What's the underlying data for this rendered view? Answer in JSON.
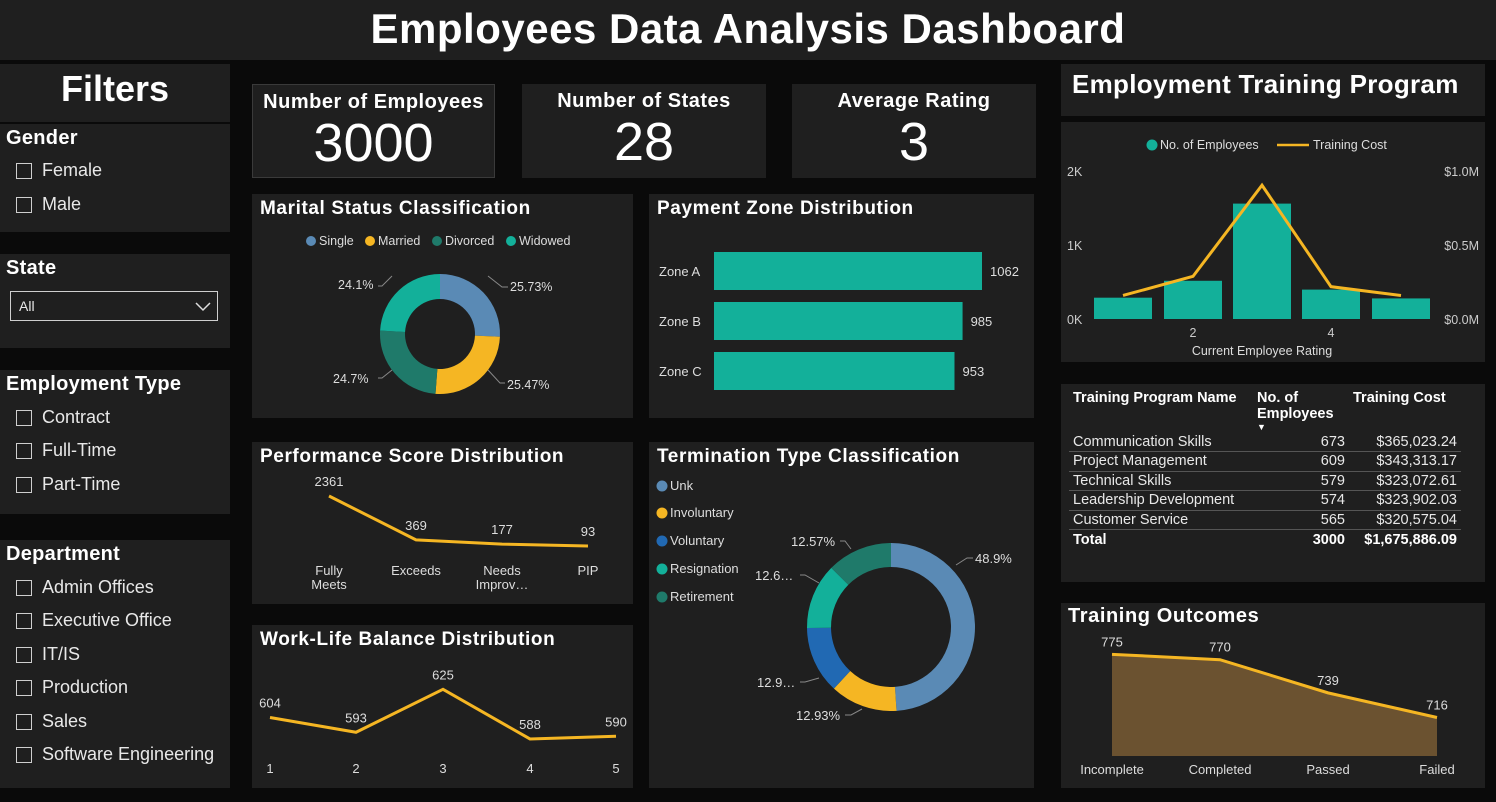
{
  "header": {
    "title": "Employees Data Analysis Dashboard"
  },
  "filters": {
    "title": "Filters",
    "gender": {
      "label": "Gender",
      "options": [
        "Female",
        "Male"
      ]
    },
    "state": {
      "label": "State",
      "selected": "All"
    },
    "employment_type": {
      "label": "Employment Type",
      "options": [
        "Contract",
        "Full-Time",
        "Part-Time"
      ]
    },
    "department": {
      "label": "Department",
      "options": [
        "Admin Offices",
        "Executive Office",
        "IT/IS",
        "Production",
        "Sales",
        "Software Engineering"
      ]
    }
  },
  "kpis": [
    {
      "title": "Number of Employees",
      "value": "3000"
    },
    {
      "title": "Number of States",
      "value": "28"
    },
    {
      "title": "Average Rating",
      "value": "3"
    }
  ],
  "colors": {
    "teal": "#13b09a",
    "gold": "#f5b623",
    "steel_blue": "#5a8ab5",
    "dark_teal": "#1f7a6a",
    "blue": "#2169b3",
    "brown_fill": "#6b5230",
    "panel": "#1f1f1f"
  },
  "marital": {
    "title": "Marital Status Classification",
    "legend": [
      "Single",
      "Married",
      "Divorced",
      "Widowed"
    ],
    "labels": [
      "25.73%",
      "25.47%",
      "24.7%",
      "24.1%"
    ],
    "chart_data": {
      "type": "pie",
      "categories": [
        "Single",
        "Married",
        "Divorced",
        "Widowed"
      ],
      "values": [
        25.73,
        25.47,
        24.7,
        24.1
      ]
    }
  },
  "payment_zone": {
    "title": "Payment Zone Distribution",
    "chart_data": {
      "type": "bar",
      "categories": [
        "Zone A",
        "Zone B",
        "Zone C"
      ],
      "values": [
        1062,
        985,
        953
      ]
    }
  },
  "performance": {
    "title": "Performance Score Distribution",
    "categories": [
      "Fully\nMeets",
      "Exceeds",
      "Needs\nImprov…",
      "PIP"
    ],
    "chart_data": {
      "type": "line",
      "categories": [
        "Fully Meets",
        "Exceeds",
        "Needs Improvement",
        "PIP"
      ],
      "values": [
        2361,
        369,
        177,
        93
      ]
    }
  },
  "termination": {
    "title": "Termination Type Classification",
    "legend": [
      "Unk",
      "Involuntary",
      "Voluntary",
      "Resignation",
      "Retirement"
    ],
    "labels": [
      "48.9%",
      "12.93%",
      "12.9…",
      "12.6…",
      "12.57%"
    ],
    "chart_data": {
      "type": "pie",
      "categories": [
        "Unk",
        "Involuntary",
        "Voluntary",
        "Resignation",
        "Retirement"
      ],
      "values": [
        48.9,
        12.93,
        12.9,
        12.6,
        12.57
      ]
    }
  },
  "worklife": {
    "title": "Work-Life Balance Distribution",
    "chart_data": {
      "type": "line",
      "categories": [
        "1",
        "2",
        "3",
        "4",
        "5"
      ],
      "values": [
        604,
        593,
        625,
        588,
        590
      ]
    }
  },
  "training_program": {
    "title": "Employment Training Program",
    "legend": [
      "No. of Employees",
      "Training Cost"
    ],
    "left_ticks": [
      "2K",
      "1K",
      "0K"
    ],
    "right_ticks": [
      "$1.0M",
      "$0.5M",
      "$0.0M"
    ],
    "x_ticks": [
      "2",
      "4"
    ],
    "xlabel": "Current Employee Rating",
    "chart_data": {
      "type": "bar",
      "categories": [
        1,
        2,
        3,
        4,
        5
      ],
      "series": [
        {
          "name": "No. of Employees",
          "values": [
            290,
            520,
            1570,
            400,
            280
          ]
        },
        {
          "name": "Training Cost",
          "values": [
            160000,
            290000,
            910000,
            220000,
            160000
          ]
        }
      ],
      "xlabel": "Current Employee Rating",
      "ylim": [
        0,
        2000
      ],
      "y2lim": [
        0,
        1000000
      ]
    }
  },
  "training_table": {
    "headers": [
      "Training Program Name",
      "No. of Employees",
      "Training Cost"
    ],
    "rows": [
      [
        "Communication Skills",
        "673",
        "$365,023.24"
      ],
      [
        "Project Management",
        "609",
        "$343,313.17"
      ],
      [
        "Technical Skills",
        "579",
        "$323,072.61"
      ],
      [
        "Leadership Development",
        "574",
        "$323,902.03"
      ],
      [
        "Customer Service",
        "565",
        "$320,575.04"
      ]
    ],
    "total": [
      "Total",
      "3000",
      "$1,675,886.09"
    ]
  },
  "outcomes": {
    "title": "Training Outcomes",
    "chart_data": {
      "type": "area",
      "categories": [
        "Incomplete",
        "Completed",
        "Passed",
        "Failed"
      ],
      "values": [
        775,
        770,
        739,
        716
      ]
    }
  }
}
